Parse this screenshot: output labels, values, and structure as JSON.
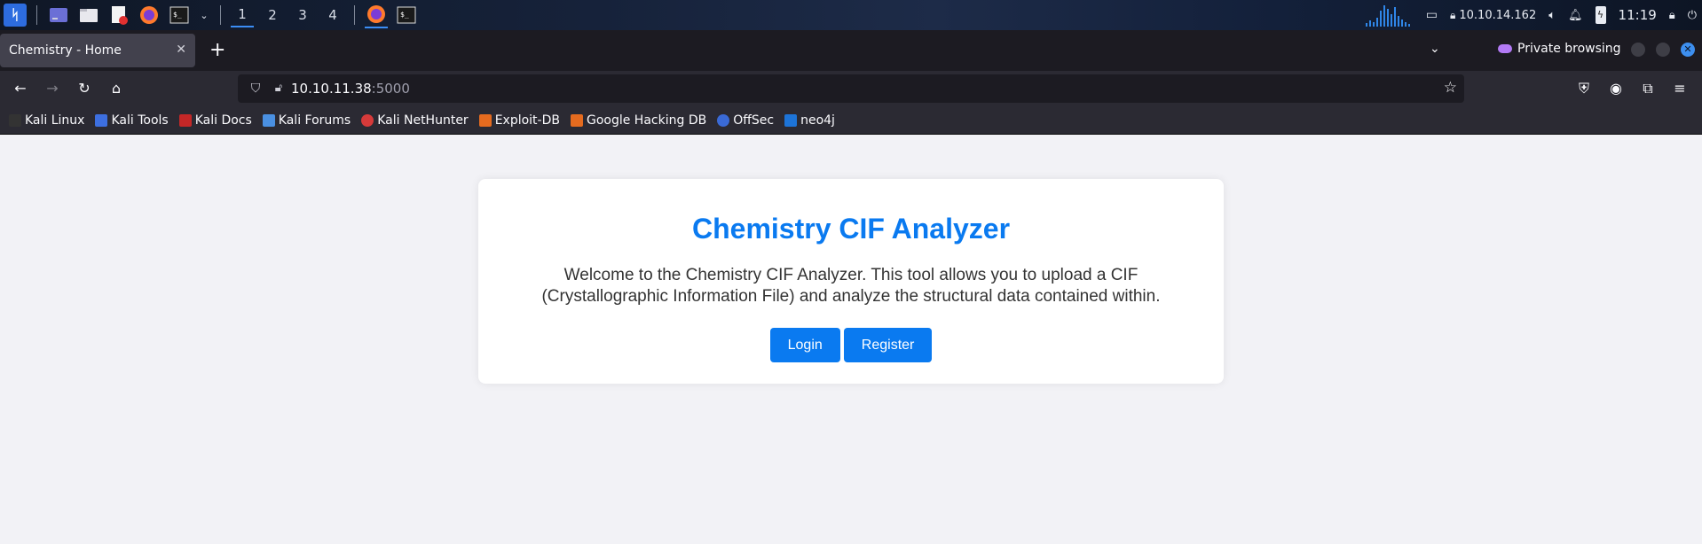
{
  "taskbar": {
    "workspaces": [
      "1",
      "2",
      "3",
      "4"
    ],
    "ip": "10.10.14.162",
    "clock": "11:19"
  },
  "browser": {
    "tab_title": "Chemistry - Home",
    "private_label": "Private browsing",
    "url_host": "10.10.11.38",
    "url_port": ":5000",
    "bookmarks": [
      "Kali Linux",
      "Kali Tools",
      "Kali Docs",
      "Kali Forums",
      "Kali NetHunter",
      "Exploit-DB",
      "Google Hacking DB",
      "OffSec",
      "neo4j"
    ]
  },
  "page": {
    "title": "Chemistry CIF Analyzer",
    "intro_line1": "Welcome to the Chemistry CIF Analyzer. This tool allows you to upload a CIF",
    "intro_line2": "(Crystallographic Information File) and analyze the structural data contained within.",
    "login_label": "Login",
    "register_label": "Register"
  },
  "colors": {
    "accent": "#0a7af0",
    "page_bg": "#f2f2f6",
    "card_bg": "#ffffff"
  }
}
